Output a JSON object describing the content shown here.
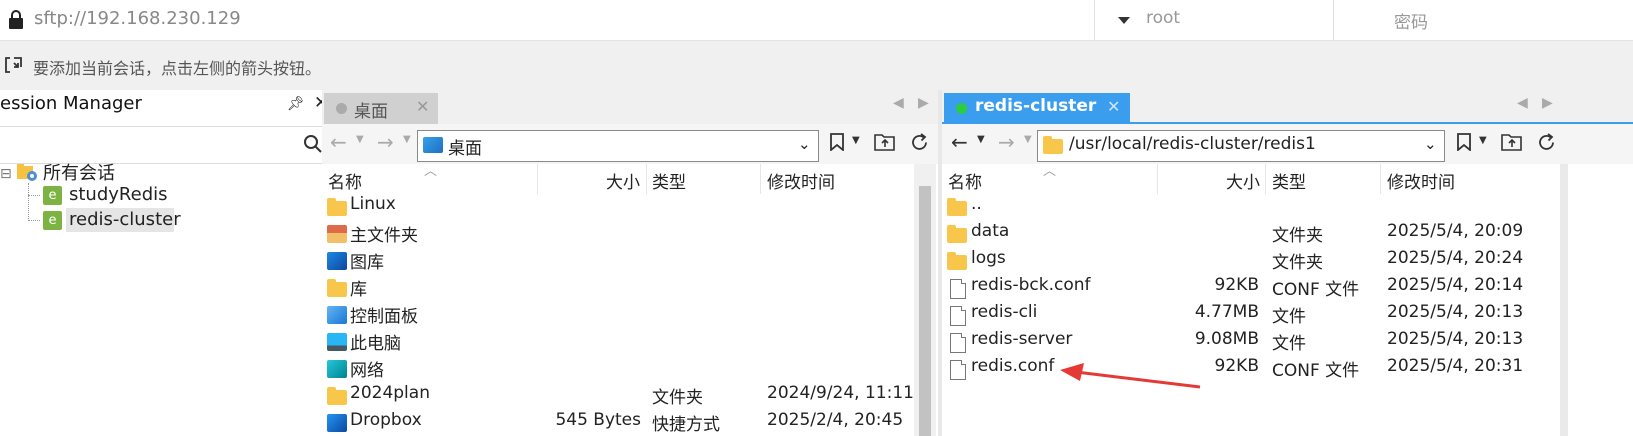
{
  "connection": {
    "url": "sftp://192.168.230.129",
    "username_placeholder": "root",
    "password_placeholder": "密码"
  },
  "hint": "要添加当前会话，点击左侧的箭头按钮。",
  "session_manager": {
    "title": "ession Manager",
    "root_label": "所有会话",
    "sessions": [
      "studyRedis",
      "redis-cluster"
    ]
  },
  "local_panel": {
    "tab_label": "桌面",
    "path": "桌面",
    "columns": {
      "name": "名称",
      "size": "大小",
      "type": "类型",
      "modified": "修改时间"
    },
    "rows": [
      {
        "name": "Linux",
        "size": "",
        "type": "",
        "modified": "",
        "icon": "folder-icon"
      },
      {
        "name": "主文件夹",
        "size": "",
        "type": "",
        "modified": "",
        "icon": "home-icon"
      },
      {
        "name": "图库",
        "size": "",
        "type": "",
        "modified": "",
        "icon": "gallery-icon"
      },
      {
        "name": "库",
        "size": "",
        "type": "",
        "modified": "",
        "icon": "folder-icon"
      },
      {
        "name": "控制面板",
        "size": "",
        "type": "",
        "modified": "",
        "icon": "control-panel-icon"
      },
      {
        "name": "此电脑",
        "size": "",
        "type": "",
        "modified": "",
        "icon": "computer-icon"
      },
      {
        "name": "网络",
        "size": "",
        "type": "",
        "modified": "",
        "icon": "network-icon"
      },
      {
        "name": "2024plan",
        "size": "",
        "type": "文件夹",
        "modified": "2024/9/24, 11:11",
        "icon": "folder-icon"
      },
      {
        "name": "Dropbox",
        "size": "545 Bytes",
        "type": "快捷方式",
        "modified": "2025/2/4, 20:45",
        "icon": "dropbox-icon"
      }
    ]
  },
  "remote_panel": {
    "tab_label": "redis-cluster",
    "path": "/usr/local/redis-cluster/redis1",
    "columns": {
      "name": "名称",
      "size": "大小",
      "type": "类型",
      "modified": "修改时间"
    },
    "rows": [
      {
        "name": "..",
        "size": "",
        "type": "",
        "modified": "",
        "icon": "folder-icon"
      },
      {
        "name": "data",
        "size": "",
        "type": "文件夹",
        "modified": "2025/5/4, 20:09",
        "icon": "folder-icon"
      },
      {
        "name": "logs",
        "size": "",
        "type": "文件夹",
        "modified": "2025/5/4, 20:24",
        "icon": "folder-icon"
      },
      {
        "name": "redis-bck.conf",
        "size": "92KB",
        "type": "CONF 文件",
        "modified": "2025/5/4, 20:14",
        "icon": "file-icon"
      },
      {
        "name": "redis-cli",
        "size": "4.77MB",
        "type": "文件",
        "modified": "2025/5/4, 20:13",
        "icon": "file-icon"
      },
      {
        "name": "redis-server",
        "size": "9.08MB",
        "type": "文件",
        "modified": "2025/5/4, 20:13",
        "icon": "file-icon"
      },
      {
        "name": "redis.conf",
        "size": "92KB",
        "type": "CONF 文件",
        "modified": "2025/5/4, 20:31",
        "icon": "file-icon"
      }
    ]
  },
  "colors": {
    "active_tab": "#3b9ded",
    "annotation_arrow": "#e53935",
    "connected_dot": "#2ecc40"
  }
}
